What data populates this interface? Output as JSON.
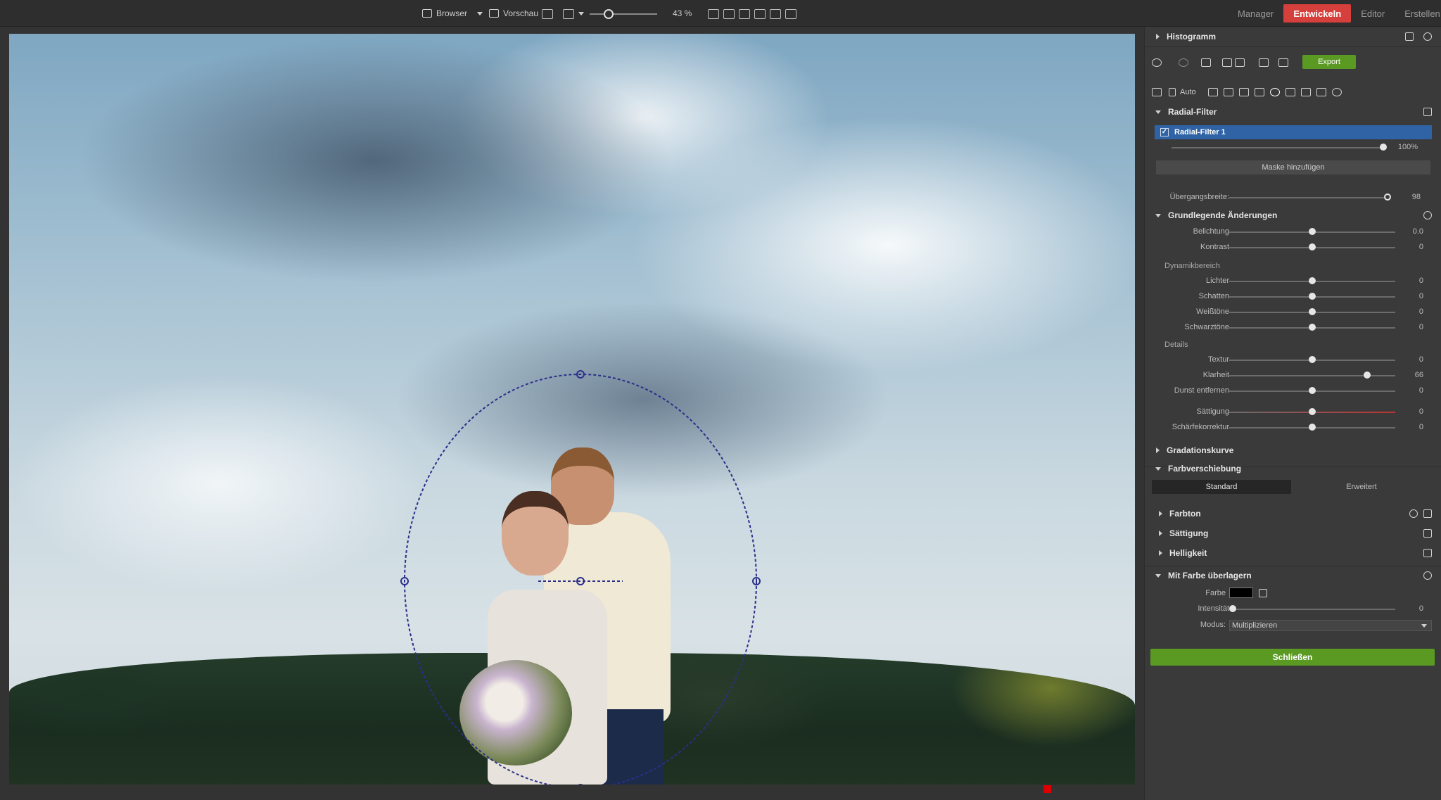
{
  "topbar": {
    "browser_label": "Browser",
    "preview_label": "Vorschau",
    "zoom_text": "43 %",
    "modes": [
      "Manager",
      "Entwickeln",
      "Editor",
      "Erstellen"
    ],
    "active_mode": "Entwickeln",
    "zoom_level_percent": 43
  },
  "panel": {
    "histogram_label": "Histogramm",
    "export_label": "Export",
    "auto_label": "Auto",
    "radial_filter_title": "Radial-Filter",
    "filter_item": "Radial-Filter 1",
    "filter_opacity": "100%",
    "filter_opacity_fraction": 1.0,
    "add_mask_label": "Maske hinzufügen",
    "transition": {
      "label": "Übergangsbreite:",
      "value": "98",
      "fraction": 0.98
    },
    "basic_title": "Grundlegende Änderungen",
    "sliders_1": [
      {
        "label": "Belichtung",
        "value": "0.0",
        "pos": 0.5
      },
      {
        "label": "Kontrast",
        "value": "0",
        "pos": 0.5
      }
    ],
    "dyn_label": "Dynamikbereich",
    "sliders_2": [
      {
        "label": "Lichter",
        "value": "0",
        "pos": 0.5
      },
      {
        "label": "Schatten",
        "value": "0",
        "pos": 0.5
      },
      {
        "label": "Weißtöne",
        "value": "0",
        "pos": 0.5
      },
      {
        "label": "Schwarztöne",
        "value": "0",
        "pos": 0.5
      }
    ],
    "details_label": "Details",
    "sliders_3": [
      {
        "label": "Textur",
        "value": "0",
        "pos": 0.5
      },
      {
        "label": "Klarheit",
        "value": "66",
        "pos": 0.83
      },
      {
        "label": "Dunst entfernen",
        "value": "0",
        "pos": 0.5
      }
    ],
    "sliders_4": [
      {
        "label": "Sättigung",
        "value": "0",
        "pos": 0.5
      },
      {
        "label": "Schärfekorrektur",
        "value": "0",
        "pos": 0.5
      }
    ],
    "gradation_title": "Gradationskurve",
    "colorshift_title": "Farbverschiebung",
    "seg_standard": "Standard",
    "seg_extended": "Erweitert",
    "sub_sections": [
      "Farbton",
      "Sättigung",
      "Helligkeit"
    ],
    "overlay_title": "Mit Farbe überlagern",
    "color_label": "Farbe",
    "intensity": {
      "label": "Intensität",
      "value": "0",
      "pos": 0.0
    },
    "mode_label": "Modus:",
    "mode_value": "Multiplizieren",
    "close_label": "Schließen",
    "colors": {
      "accent_green": "#5a9a22",
      "active_mode_red": "#d6403c",
      "selection_blue": "#2f63a6",
      "mask_outline": "#2a2f8a"
    }
  }
}
